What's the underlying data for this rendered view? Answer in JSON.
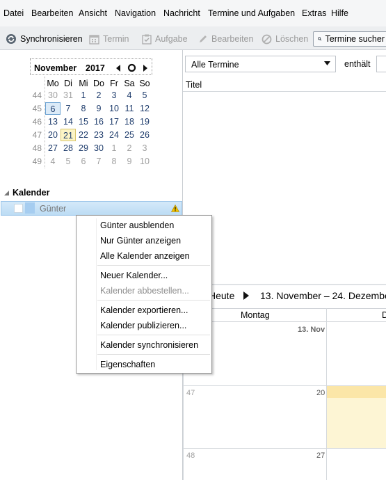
{
  "menubar": {
    "items": [
      "Datei",
      "Bearbeiten",
      "Ansicht",
      "Navigation",
      "Nachricht",
      "Termine und Aufgaben",
      "Extras",
      "Hilfe"
    ]
  },
  "toolbar": {
    "sync_label": "Synchronisieren",
    "event_label": "Termin",
    "task_label": "Aufgabe",
    "edit_label": "Bearbeiten",
    "delete_label": "Löschen",
    "search_label": "Termine sucher"
  },
  "minimonth": {
    "month": "November",
    "year": "2017",
    "weekdays": [
      "Mo",
      "Di",
      "Mi",
      "Do",
      "Fr",
      "Sa",
      "So"
    ],
    "weeks": [
      {
        "num": "44",
        "days": [
          "30",
          "31",
          "1",
          "2",
          "3",
          "4",
          "5"
        ]
      },
      {
        "num": "45",
        "days": [
          "6",
          "7",
          "8",
          "9",
          "10",
          "11",
          "12"
        ]
      },
      {
        "num": "46",
        "days": [
          "13",
          "14",
          "15",
          "16",
          "17",
          "18",
          "19"
        ]
      },
      {
        "num": "47",
        "days": [
          "20",
          "21",
          "22",
          "23",
          "24",
          "25",
          "26"
        ]
      },
      {
        "num": "48",
        "days": [
          "27",
          "28",
          "29",
          "30",
          "1",
          "2",
          "3"
        ]
      },
      {
        "num": "49",
        "days": [
          "4",
          "5",
          "6",
          "7",
          "8",
          "9",
          "10"
        ]
      }
    ]
  },
  "calendars": {
    "heading": "Kalender",
    "items": [
      {
        "name": "Günter"
      }
    ]
  },
  "context_menu": {
    "items": [
      {
        "label": "Günter ausblenden",
        "disabled": false
      },
      {
        "label": "Nur Günter anzeigen",
        "disabled": false
      },
      {
        "label": "Alle Kalender anzeigen",
        "disabled": false
      },
      {
        "label": "Neuer Kalender...",
        "disabled": false
      },
      {
        "label": "Kalender abbestellen...",
        "disabled": true
      },
      {
        "label": "Kalender exportieren...",
        "disabled": false
      },
      {
        "label": "Kalender publizieren...",
        "disabled": false
      },
      {
        "label": "Kalender synchronisieren",
        "disabled": false
      },
      {
        "label": "Eigenschaften",
        "disabled": false
      }
    ]
  },
  "filter": {
    "selected": "Alle Termine",
    "contains_label": "enthält"
  },
  "list": {
    "title_column": "Titel"
  },
  "view": {
    "today_label": "Heute",
    "range_label": "13. November – 24. Dezembe",
    "columns": [
      "Montag",
      "D"
    ],
    "rows": [
      {
        "week": "",
        "dates": [
          "13. Nov"
        ]
      },
      {
        "week": "47",
        "dates": [
          "20"
        ]
      },
      {
        "week": "48",
        "dates": [
          "27"
        ]
      }
    ]
  },
  "colors": {
    "selected_day_bg": "#dcebf8",
    "today_bg": "#fbf4c6",
    "calendar_row": "#bcdcf4",
    "warning": "#f2c200"
  }
}
